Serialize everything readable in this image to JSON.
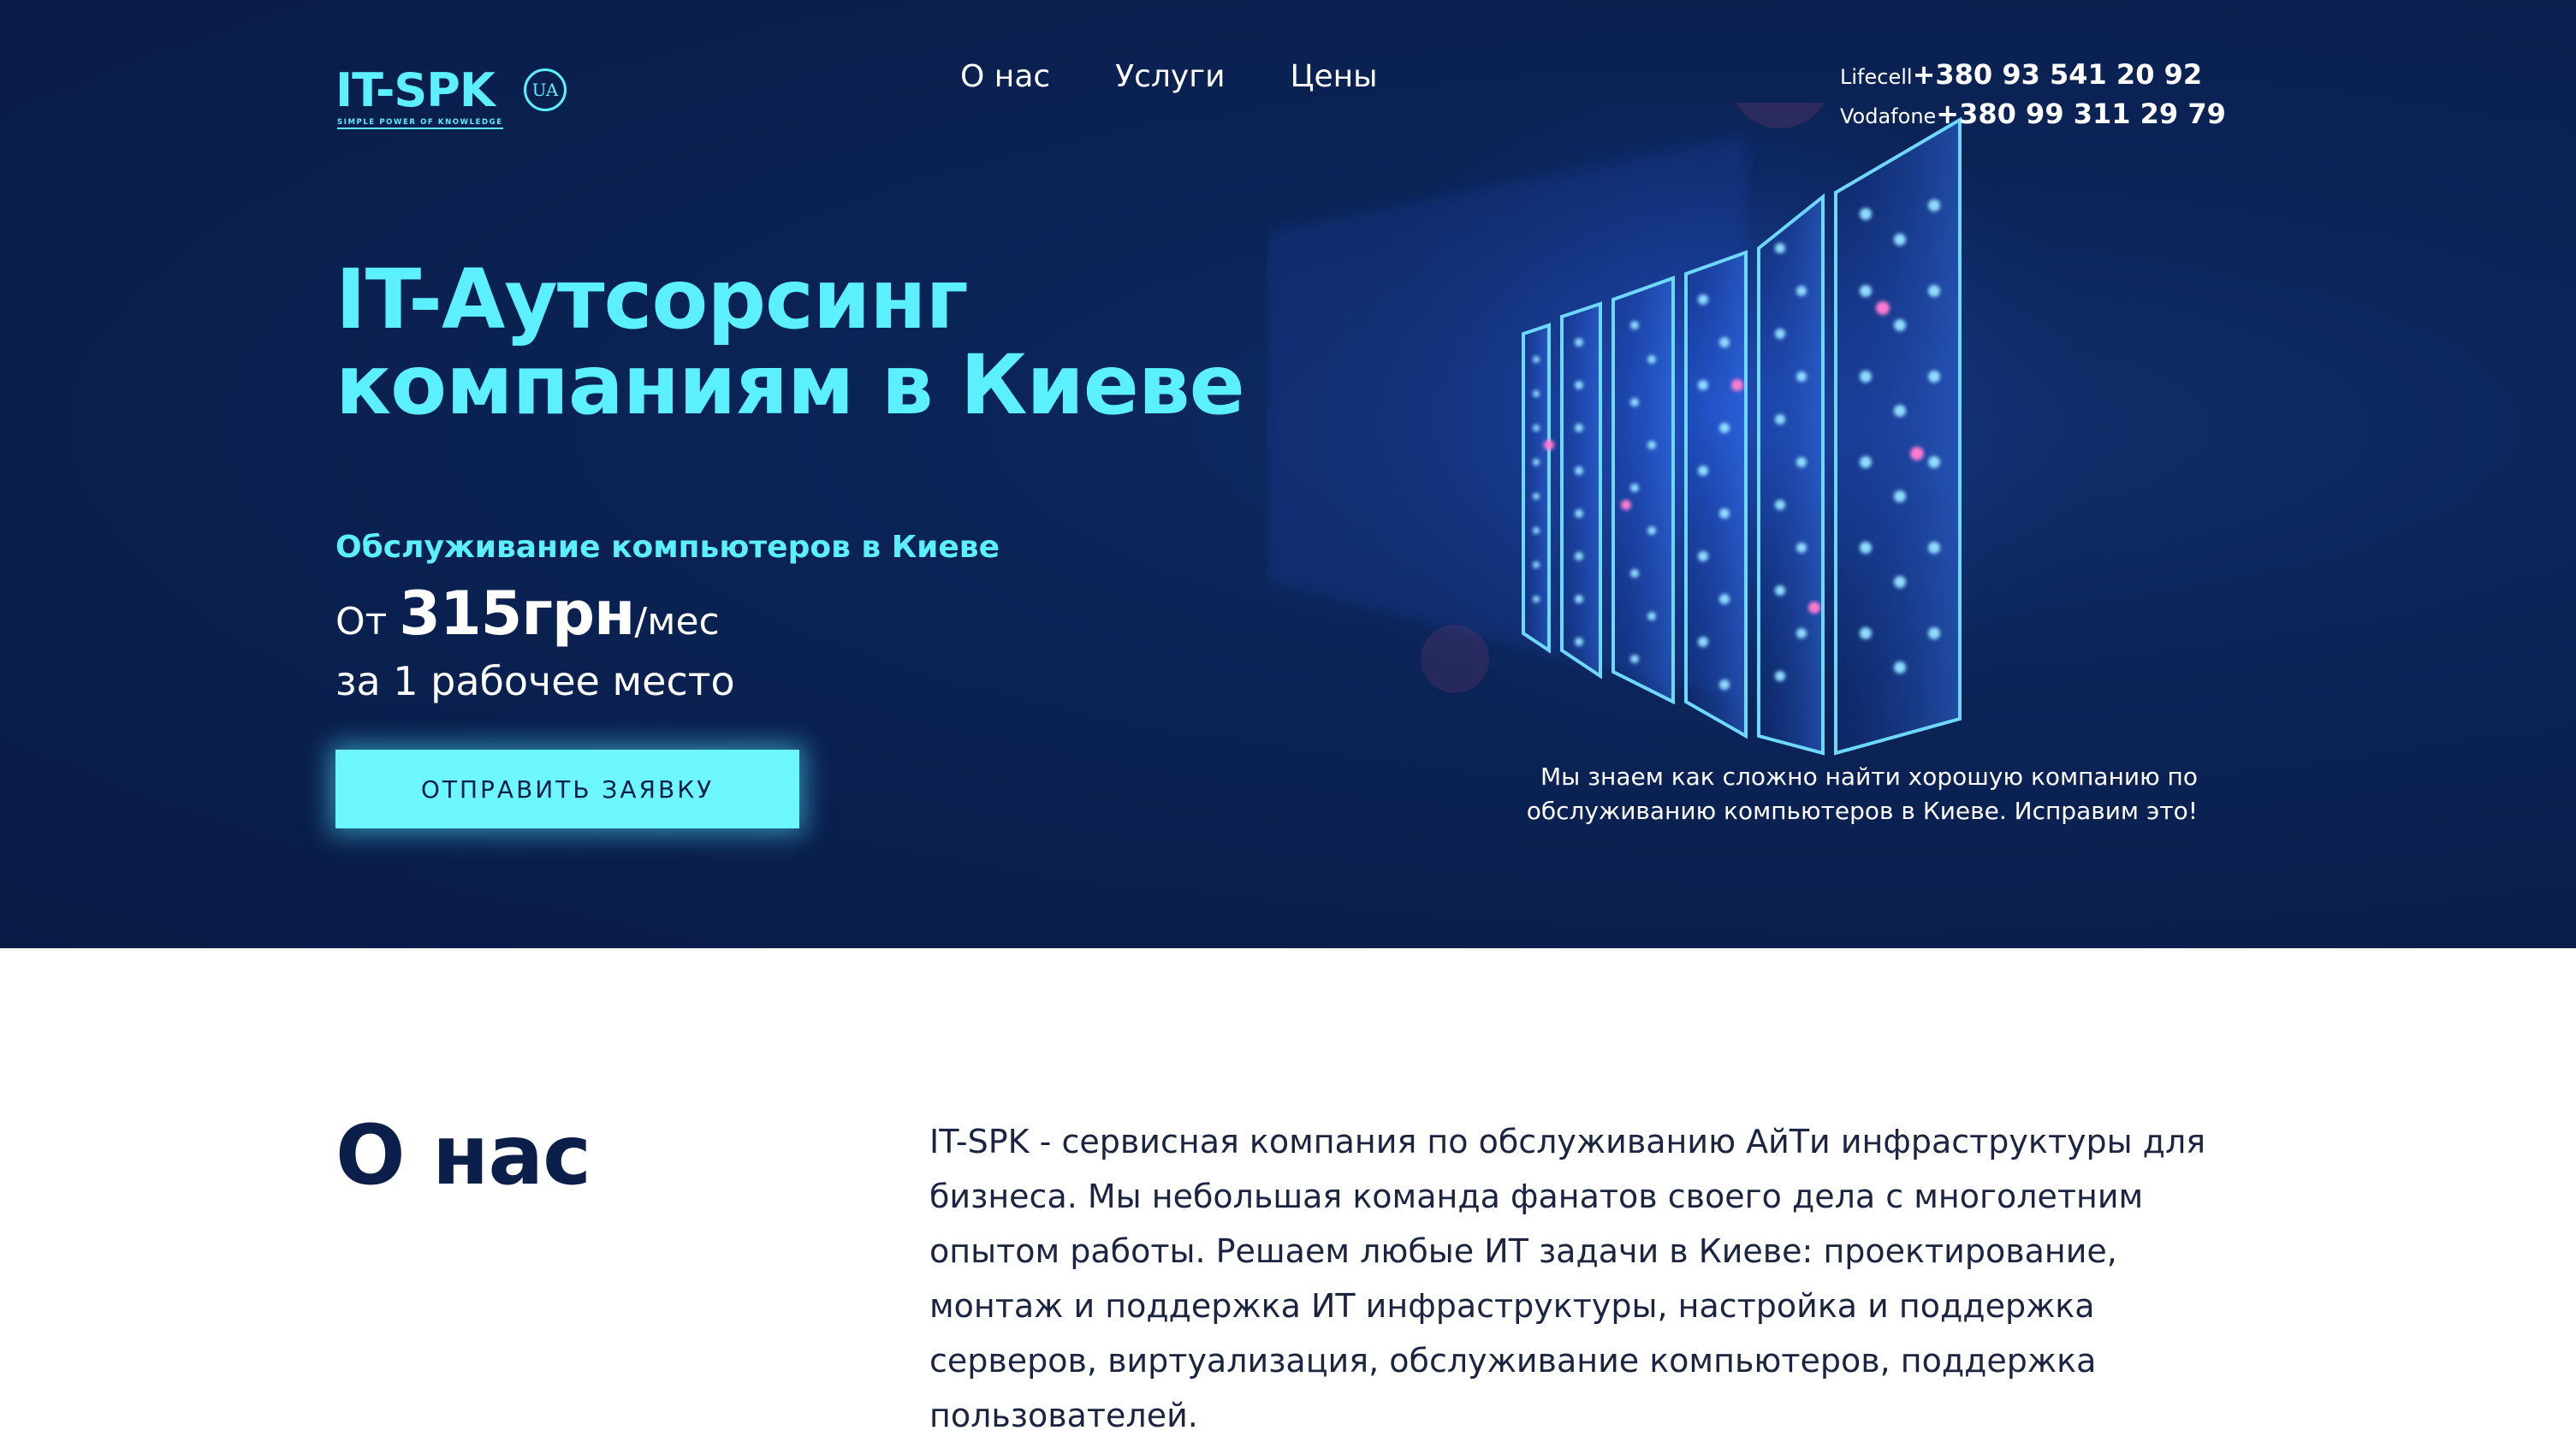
{
  "header": {
    "logo_text": "IT-SPK",
    "logo_tagline": "SIMPLE POWER OF KNOWLEDGE",
    "language": "UA",
    "nav": [
      "О нас",
      "Услуги",
      "Цены"
    ],
    "phones": [
      {
        "operator": "Lifecell",
        "number": "+380 93 541 20 92"
      },
      {
        "operator": "Vodafone",
        "number": "+380 99 311 29 79"
      }
    ]
  },
  "hero": {
    "headline_line1": "IT-Аутсорсинг",
    "headline_line2": "компаниям в Киеве",
    "subtitle": "Обслуживание компьютеров в Киеве",
    "price_prefix": "От ",
    "price_value": "315грн",
    "price_suffix": "/мес",
    "price_per": "за 1 рабочее место",
    "cta_label": "ОТПРАВИТЬ ЗАЯВКУ",
    "note_line1": "Мы знаем как сложно найти хорошую компанию по",
    "note_line2": "обслуживанию компьютеров в Киеве. Исправим это!"
  },
  "about": {
    "title": "О нас",
    "text": "IT-SPK - сервисная компания по обслуживанию АйТи инфраструктуры для бизнеса. Мы небольшая команда фанатов своего дела с многолетним опытом работы. Решаем любые ИТ задачи в Киеве: проектирование, монтаж и поддержка ИТ инфраструктуры, настройка и поддержка серверов, виртуализация, обслуживание компьютеров, поддержка пользователей."
  },
  "colors": {
    "hero_bg": "#0b2457",
    "accent": "#5cf0ff",
    "cta_bg": "#6ef6ff",
    "dark_text": "#0b1f4a"
  }
}
